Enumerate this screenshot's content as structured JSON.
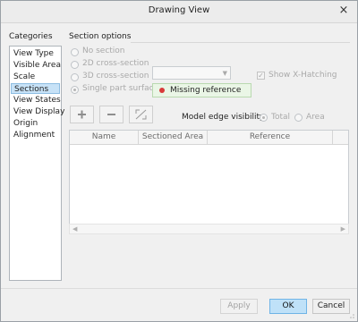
{
  "window": {
    "title": "Drawing View",
    "close_glyph": "×"
  },
  "categories": {
    "label": "Categories",
    "items": [
      "View Type",
      "Visible Area",
      "Scale",
      "Sections",
      "View States",
      "View Display",
      "Origin",
      "Alignment"
    ],
    "selected": "Sections"
  },
  "section_options": {
    "heading": "Section options",
    "radios": [
      "No section",
      "2D cross-section",
      "3D cross-section",
      "Single part surface"
    ],
    "selected": "Single part surface",
    "combo_value": "",
    "show_xhatching_label": "Show X-Hatching",
    "show_xhatching_checked": true,
    "missing_reference": "Missing reference"
  },
  "toolbar": {
    "add_icon": "plus-icon",
    "remove_icon": "minus-icon",
    "flip_icon": "flip-arrows-icon"
  },
  "model_edge": {
    "label": "Model edge visibility",
    "options": [
      "Total",
      "Area"
    ],
    "selected": "Total"
  },
  "table": {
    "columns": [
      "Name",
      "Sectioned Area",
      "Reference"
    ],
    "rows": []
  },
  "buttons": {
    "apply": "Apply",
    "ok": "OK",
    "cancel": "Cancel"
  },
  "colors": {
    "accent": "#bfe1f8",
    "missing_dot": "#d93a3a",
    "selected_item": "#c7e2f7"
  }
}
